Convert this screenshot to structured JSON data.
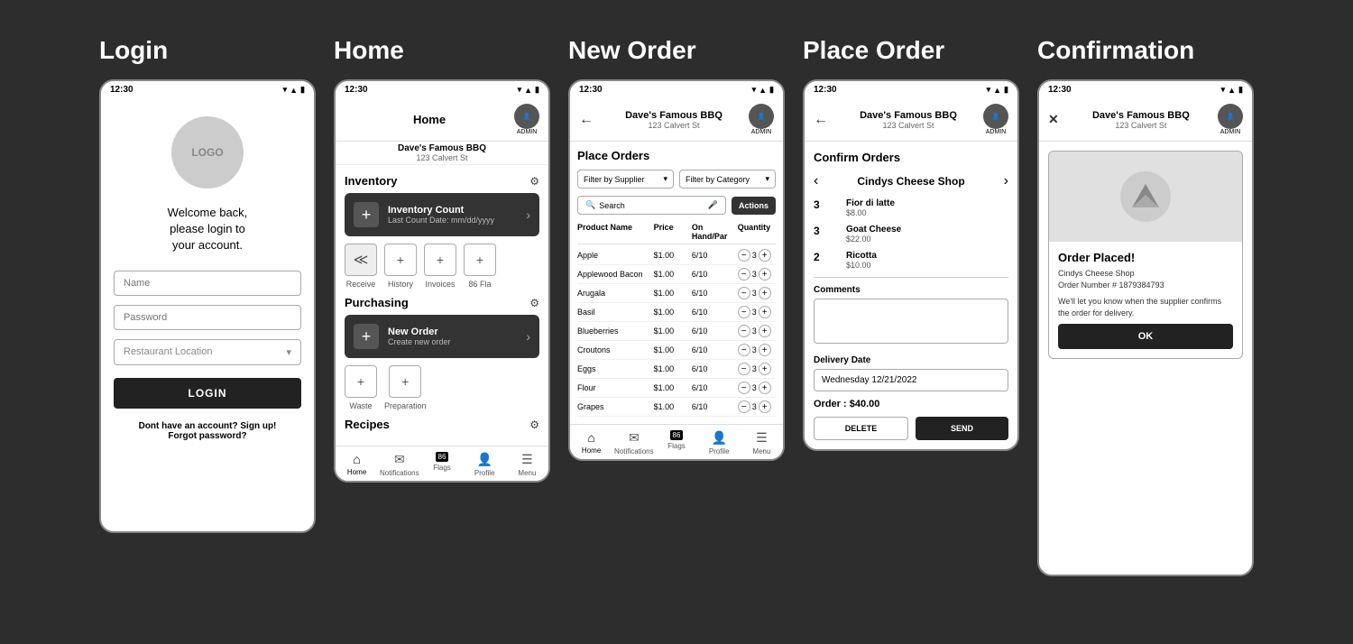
{
  "screens": {
    "login": {
      "title": "Login",
      "time": "12:30",
      "logo_text": "LOGO",
      "welcome_text": "Welcome back,",
      "welcome_sub": "please login to\nyour account.",
      "name_placeholder": "Name",
      "password_placeholder": "Password",
      "location_placeholder": "Restaurant Location",
      "login_btn": "LOGIN",
      "no_account": "Dont have an account?",
      "signup": "Sign up!",
      "forgot": "Forgot password?"
    },
    "home": {
      "title": "Home",
      "time": "12:30",
      "restaurant_name": "Dave's Famous BBQ",
      "address": "123 Calvert St",
      "admin_label": "ADMIN",
      "page_title": "Home",
      "sections": {
        "inventory": {
          "label": "Inventory",
          "card_title": "Inventory Count",
          "card_sub": "Last Count Date: mm/dd/yyyy",
          "quick_actions": [
            "Receive",
            "History",
            "Invoices",
            "86 Fla"
          ]
        },
        "purchasing": {
          "label": "Purchasing",
          "card_title": "New Order",
          "card_sub": "Create new order",
          "quick_actions": [
            "Waste",
            "Preparation"
          ]
        },
        "recipes": {
          "label": "Recipes"
        }
      },
      "nav": {
        "home": "Home",
        "notifications": "Notifications",
        "flags": "86",
        "profile": "Profile",
        "menu": "Menu"
      }
    },
    "new_order": {
      "title": "New Order",
      "time": "12:30",
      "restaurant_name": "Dave's Famous BBQ",
      "address": "123 Calvert St",
      "admin_label": "ADMIN",
      "page_title": "Place Orders",
      "filter_supplier": "Filter by Supplier",
      "filter_category": "Filter by Category",
      "search_placeholder": "Search",
      "actions_btn": "Actions",
      "table_headers": [
        "Product Name",
        "Price",
        "On Hand/Par",
        "Quantity"
      ],
      "products": [
        {
          "name": "Apple",
          "price": "$1.00",
          "on_hand": "6/10",
          "qty": "3"
        },
        {
          "name": "Applewood Bacon",
          "price": "$1.00",
          "on_hand": "6/10",
          "qty": "3"
        },
        {
          "name": "Arugala",
          "price": "$1.00",
          "on_hand": "6/10",
          "qty": "3"
        },
        {
          "name": "Basil",
          "price": "$1.00",
          "on_hand": "6/10",
          "qty": "3"
        },
        {
          "name": "Blueberries",
          "price": "$1.00",
          "on_hand": "6/10",
          "qty": "3"
        },
        {
          "name": "Croutons",
          "price": "$1.00",
          "on_hand": "6/10",
          "qty": "3"
        },
        {
          "name": "Eggs",
          "price": "$1.00",
          "on_hand": "6/10",
          "qty": "3"
        },
        {
          "name": "Flour",
          "price": "$1.00",
          "on_hand": "6/10",
          "qty": "3"
        },
        {
          "name": "Grapes",
          "price": "$1.00",
          "on_hand": "6/10",
          "qty": "3"
        }
      ],
      "nav": {
        "home": "Home",
        "notifications": "Notifications",
        "flags": "86",
        "profile": "Profile",
        "menu": "Menu"
      }
    },
    "place_order": {
      "title": "Place Order",
      "time": "12:30",
      "restaurant_name": "Dave's Famous BBQ",
      "address": "123 Calvert St",
      "admin_label": "ADMIN",
      "page_title": "Confirm Orders",
      "supplier": "Cindys Cheese Shop",
      "items": [
        {
          "qty": "3",
          "name": "Fior di latte",
          "price": "$8.00"
        },
        {
          "qty": "3",
          "name": "Goat Cheese",
          "price": "$22.00"
        },
        {
          "qty": "2",
          "name": "Ricotta",
          "price": "$10.00"
        }
      ],
      "comments_label": "Comments",
      "delivery_label": "Delivery Date",
      "delivery_date": "Wednesday 12/21/2022",
      "order_total": "Order : $40.00",
      "delete_btn": "DELETE",
      "send_btn": "SEND"
    },
    "confirmation": {
      "title": "Confirmation",
      "time": "12:30",
      "restaurant_name": "Dave's Famous BBQ",
      "address": "123 Calvert St",
      "admin_label": "ADMIN",
      "order_placed": "Order Placed!",
      "supplier": "Cindys Cheese Shop",
      "order_number": "Order Number # 1879384793",
      "message": "We'll let you know when the supplier confirms\nthe order for delivery.",
      "ok_btn": "OK"
    }
  }
}
